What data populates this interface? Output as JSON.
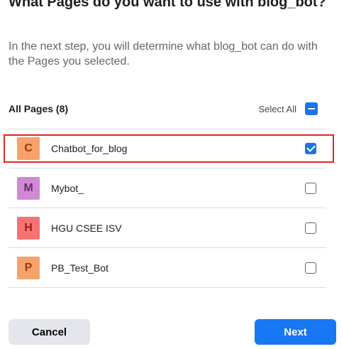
{
  "dialog": {
    "title": "What Pages do you want to use with blog_bot?",
    "subtitle": "In the next step, you will determine what blog_bot can do with the Pages you selected."
  },
  "list": {
    "header_label": "All Pages (8)",
    "select_all_label": "Select All",
    "select_all_state": "indeterminate",
    "pages": [
      {
        "initial": "C",
        "name": "Chatbot_for_blog",
        "checked": true,
        "avatar_bg": "#f7a26b",
        "avatar_fg": "#a5360f"
      },
      {
        "initial": "M",
        "name": "Mybot_",
        "checked": false,
        "avatar_bg": "#d08ad1",
        "avatar_fg": "#6e2a78"
      },
      {
        "initial": "H",
        "name": "HGU CSEE ISV",
        "checked": false,
        "avatar_bg": "#f77272",
        "avatar_fg": "#9b1b1b"
      },
      {
        "initial": "P",
        "name": "PB_Test_Bot",
        "checked": false,
        "avatar_bg": "#f7a26b",
        "avatar_fg": "#a5360f"
      }
    ]
  },
  "buttons": {
    "cancel_label": "Cancel",
    "next_label": "Next"
  },
  "colors": {
    "primary": "#1877f2",
    "checkbox_blue": "#1b74e4",
    "highlight_red": "#e3261b"
  }
}
